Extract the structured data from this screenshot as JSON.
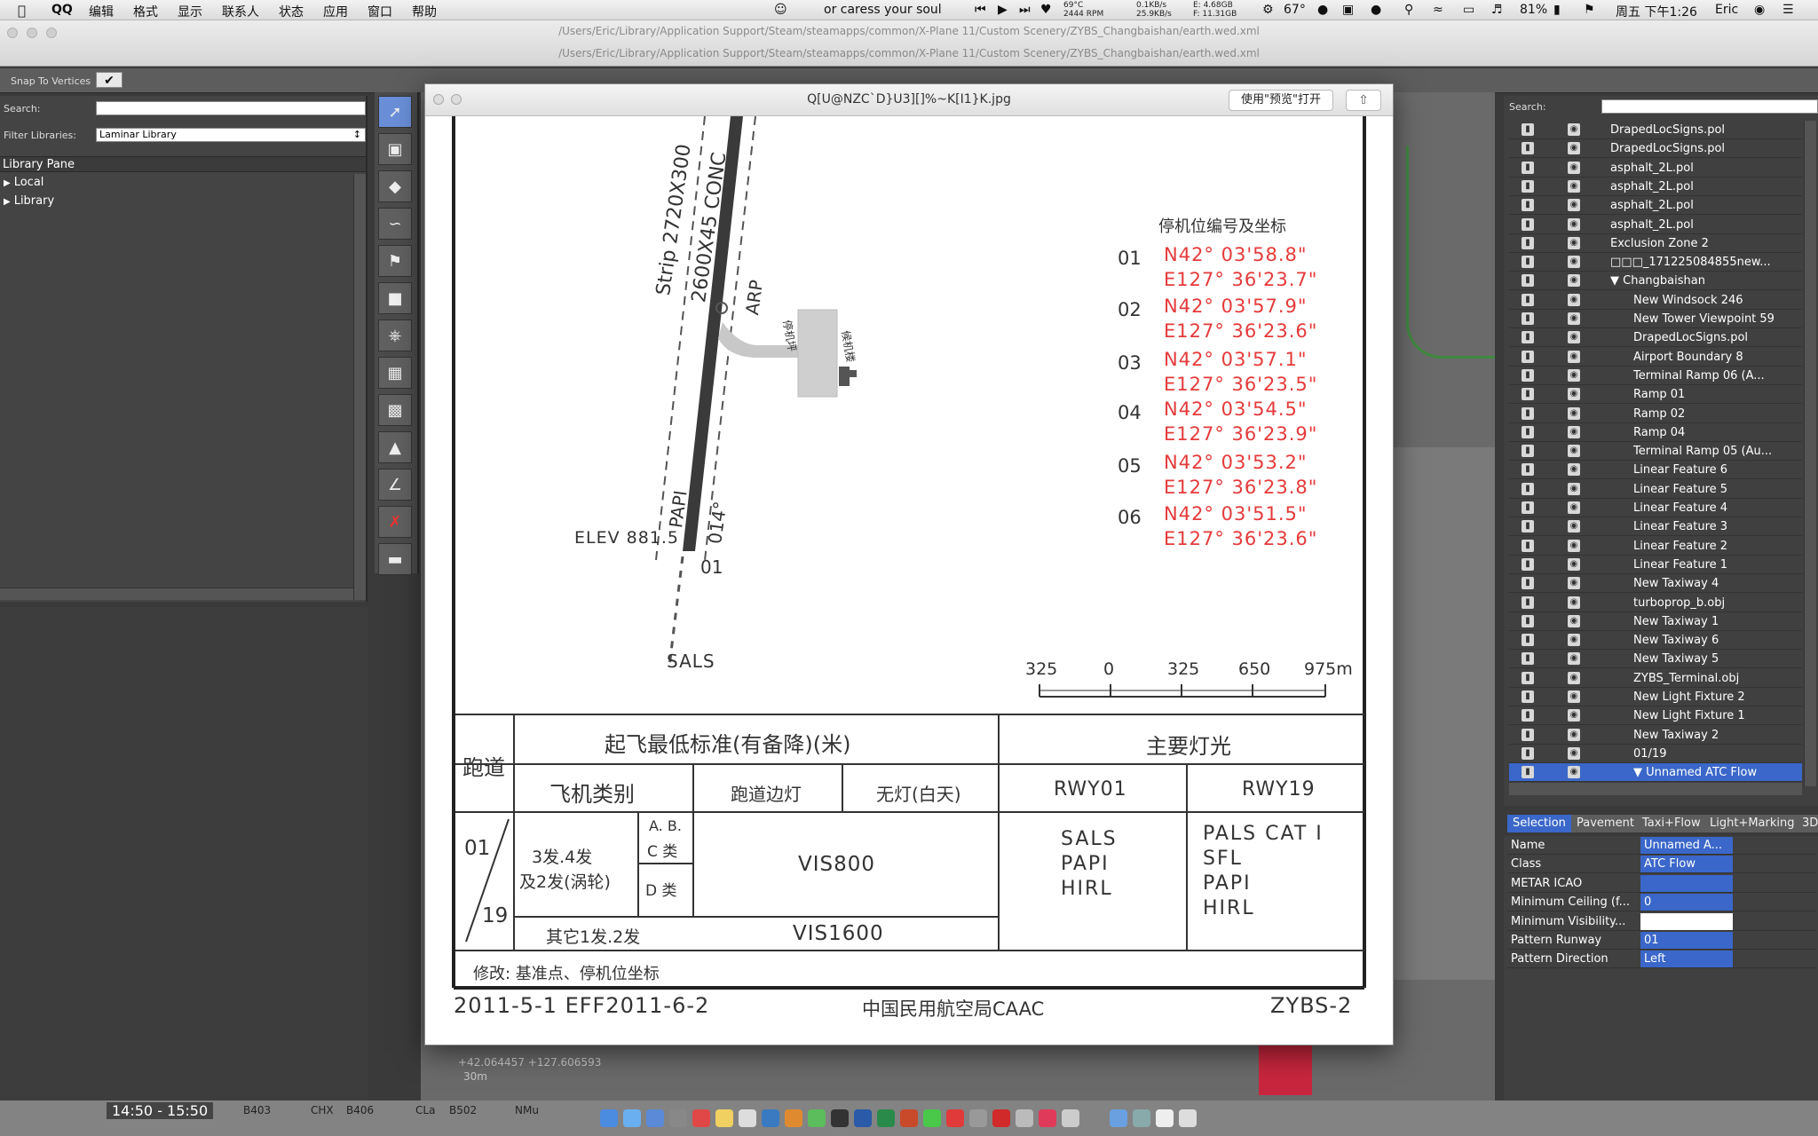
{
  "menubar": {
    "apple_icon": "apple-icon",
    "items": [
      "QQ",
      "编辑",
      "格式",
      "显示",
      "联系人",
      "状态",
      "应用",
      "窗口",
      "帮助"
    ],
    "now_playing": "or caress your soul",
    "temp_top": "69°C",
    "temp_rpm": "2444 RPM",
    "net_up": "0.1KB/s",
    "net_down": "25.9KB/s",
    "mem_e": "E: 4.68GB",
    "mem_f": "F: 11.31GB",
    "weather": "67°",
    "battery": "81%",
    "datetime": "周五 下午1:26",
    "user": "Eric"
  },
  "wed_window": {
    "path_top": "/Users/Eric/Library/Application Support/Steam/steamapps/common/X-Plane 11/Custom Scenery/ZYBS_Changbaishan/earth.wed.xml",
    "path_second": "/Users/Eric/Library/Application Support/Steam/steamapps/common/X-Plane 11/Custom Scenery/ZYBS_Changbaishan/earth.wed.xml"
  },
  "toolbar": {
    "snap_label": "Snap To Vertices",
    "snap_check": "✔"
  },
  "library": {
    "search_label": "Search:",
    "filter_label": "Filter Libraries:",
    "filter_value": "Laminar Library",
    "pane_title": "Library Pane",
    "items": [
      "Local",
      "Library"
    ]
  },
  "map": {
    "coords": "+42.064457 +127.606593",
    "scale": "30m"
  },
  "preview": {
    "title": "Q[U@NZC`D}U3][]%~K[I1}K.jpg",
    "open_button": "使用\"预览\"打开",
    "chart": {
      "stand_title": "停机位编号及坐标",
      "stands": [
        {
          "id": "01",
          "n": "N42° 03'58.8\"",
          "e": "E127° 36'23.7\""
        },
        {
          "id": "02",
          "n": "N42° 03'57.9\"",
          "e": "E127° 36'23.6\""
        },
        {
          "id": "03",
          "n": "N42° 03'57.1\"",
          "e": "E127° 36'23.5\""
        },
        {
          "id": "04",
          "n": "N42° 03'54.5\"",
          "e": "E127° 36'23.9\""
        },
        {
          "id": "05",
          "n": "N42° 03'53.2\"",
          "e": "E127° 36'23.8\""
        },
        {
          "id": "06",
          "n": "N42° 03'51.5\"",
          "e": "E127° 36'23.6\""
        }
      ],
      "strip_label": "Strip 2720X300",
      "runway_label": "2600X45 CONC",
      "arp": "ARP",
      "papi": "PAPI",
      "heading": "014°",
      "rwy_end": "01",
      "elev": "ELEV 881.5",
      "sals": "SALS",
      "apron": "停机坪",
      "terminal": "候机楼",
      "scale_ticks": [
        "325",
        "0",
        "325",
        "650",
        "975m"
      ],
      "table": {
        "col_runway": "跑道",
        "takeoff_header": "起飞最低标准(有备降)(米)",
        "lights_header": "主要灯光",
        "aircraft_cat": "飞机类别",
        "edge_lights": "跑道边灯",
        "no_lights": "无灯(白天)",
        "rwy01": "RWY01",
        "rwy19": "RWY19",
        "rwy_top": "01",
        "rwy_bottom": "19",
        "cat_engines": "3发.4发",
        "cat_turbo": "及2发(涡轮)",
        "cat_abc_1": "A. B.",
        "cat_abc_2": "C 类",
        "cat_d": "D 类",
        "cat_other": "其它1发.2发",
        "vis800": "VIS800",
        "vis1600": "VIS1600",
        "rwy01_lights": [
          "SALS",
          "PAPI",
          "HIRL"
        ],
        "rwy19_lights": [
          "PALS CAT I",
          "SFL",
          "PAPI",
          "HIRL"
        ],
        "amend": "修改: 基准点、停机位坐标"
      },
      "footer_left": "2011-5-1 EFF2011-6-2",
      "footer_center": "中国民用航空局CAAC",
      "footer_right": "ZYBS-2"
    }
  },
  "scene": {
    "search_label": "Search:",
    "rows": [
      {
        "name": "DrapedLocSigns.pol",
        "indent": 0
      },
      {
        "name": "DrapedLocSigns.pol",
        "indent": 0
      },
      {
        "name": "asphalt_2L.pol",
        "indent": 0
      },
      {
        "name": "asphalt_2L.pol",
        "indent": 0
      },
      {
        "name": "asphalt_2L.pol",
        "indent": 0
      },
      {
        "name": "asphalt_2L.pol",
        "indent": 0
      },
      {
        "name": "Exclusion Zone 2",
        "indent": 0
      },
      {
        "name": "□□□_171225084855new...",
        "indent": 0
      },
      {
        "name": "▼ Changbaishan",
        "indent": 0
      },
      {
        "name": "New Windsock 246",
        "indent": 1
      },
      {
        "name": "New Tower Viewpoint 59",
        "indent": 1
      },
      {
        "name": "DrapedLocSigns.pol",
        "indent": 1
      },
      {
        "name": "Airport Boundary 8",
        "indent": 1
      },
      {
        "name": "Terminal Ramp 06 (A...",
        "indent": 1
      },
      {
        "name": "Ramp 01",
        "indent": 1
      },
      {
        "name": "Ramp 02",
        "indent": 1
      },
      {
        "name": "Ramp 04",
        "indent": 1
      },
      {
        "name": "Terminal Ramp 05 (Au...",
        "indent": 1
      },
      {
        "name": "Linear Feature 6",
        "indent": 1
      },
      {
        "name": "Linear Feature 5",
        "indent": 1
      },
      {
        "name": "Linear Feature 4",
        "indent": 1
      },
      {
        "name": "Linear Feature 3",
        "indent": 1
      },
      {
        "name": "Linear Feature 2",
        "indent": 1
      },
      {
        "name": "Linear Feature 1",
        "indent": 1
      },
      {
        "name": "New Taxiway 4",
        "indent": 1
      },
      {
        "name": "turboprop_b.obj",
        "indent": 1
      },
      {
        "name": "New Taxiway 1",
        "indent": 1
      },
      {
        "name": "New Taxiway 6",
        "indent": 1
      },
      {
        "name": "New Taxiway 5",
        "indent": 1
      },
      {
        "name": "ZYBS_Terminal.obj",
        "indent": 1
      },
      {
        "name": "New Light Fixture 2",
        "indent": 1
      },
      {
        "name": "New Light Fixture 1",
        "indent": 1
      },
      {
        "name": "New Taxiway 2",
        "indent": 1
      },
      {
        "name": "01/19",
        "indent": 1
      },
      {
        "name": "▼ Unnamed ATC Flow",
        "indent": 1,
        "selected": true
      }
    ]
  },
  "prop_tabs": [
    "Selection",
    "Pavement",
    "Taxi+Flow",
    "Light+Marking",
    "3D"
  ],
  "properties": [
    {
      "label": "Name",
      "value": "Unnamed A..."
    },
    {
      "label": "Class",
      "value": "ATC Flow"
    },
    {
      "label": "METAR ICAO",
      "value": ""
    },
    {
      "label": "Minimum Ceiling (f...",
      "value": "0"
    },
    {
      "label": "Minimum Visibility...",
      "value": "",
      "white": true
    },
    {
      "label": "Pattern Runway",
      "value": "01"
    },
    {
      "label": "Pattern Direction",
      "value": "Left"
    }
  ],
  "taskstrip": {
    "time": "14:50 - 15:50",
    "labels": [
      "B403",
      "CHX",
      "B406",
      "CLa",
      "B502",
      "NMu"
    ]
  },
  "colors": {
    "accent": "#3a67c9",
    "chart_red": "#e53a3a"
  }
}
